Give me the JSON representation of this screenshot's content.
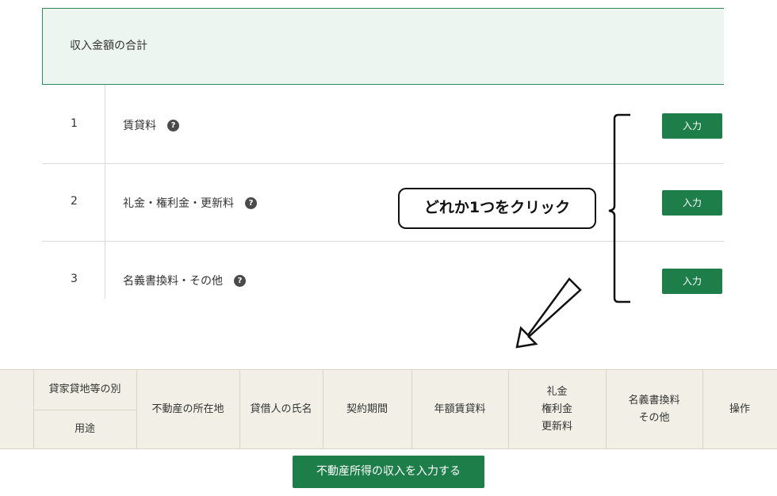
{
  "summary": {
    "title": "収入金額の合計"
  },
  "rows": [
    {
      "num": "1",
      "label": "賃貸料",
      "help": "?",
      "button": "入力"
    },
    {
      "num": "2",
      "label": "礼金・権利金・更新料",
      "help": "?",
      "button": "入力"
    },
    {
      "num": "3",
      "label": "名義書換料・その他",
      "help": "?",
      "button": "入力"
    }
  ],
  "annotation": {
    "text": "どれか1つをクリック"
  },
  "table": {
    "headers": {
      "type_top": "貸家貸地等の別",
      "type_bottom": "用途",
      "location": "不動産の所在地",
      "tenant": "貸借人の氏名",
      "period": "契約期間",
      "annual_rent": "年額賃貸料",
      "key_money": [
        "礼金",
        "権利金",
        "更新料"
      ],
      "transfer_fee": [
        "名義書換料",
        "その他"
      ],
      "action": "操作"
    }
  },
  "submit": {
    "label": "不動産所得の収入を入力する"
  },
  "colors": {
    "accent": "#1e7e4a",
    "summary_bg": "#ecf5ef",
    "table_bg": "#f1efe6"
  }
}
